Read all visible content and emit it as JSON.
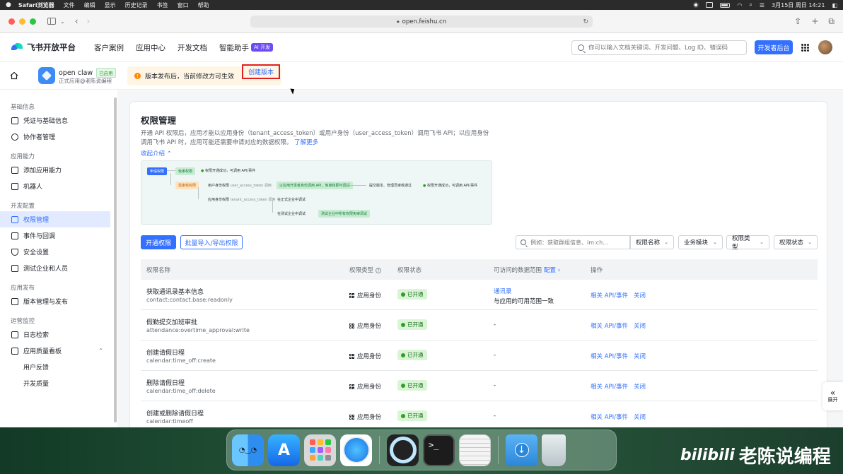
{
  "menubar": {
    "items": [
      "Safari浏览器",
      "文件",
      "编辑",
      "显示",
      "历史记录",
      "书签",
      "窗口",
      "帮助"
    ],
    "datetime": "3月15日 周日  14:21"
  },
  "browser": {
    "url": "open.feishu.cn"
  },
  "header": {
    "brand": "飞书开放平台",
    "nav": [
      "客户案例",
      "应用中心",
      "开发文档",
      "智能助手"
    ],
    "ai_badge": "AI 开发",
    "search_placeholder": "你可以输入文档关键词、开发问题、Log ID、错误码",
    "dev_console": "开发者后台"
  },
  "app": {
    "name": "open claw",
    "status": "已启用",
    "subtitle": "正式应用@老陈说编程",
    "notice": "版本发布后，当前修改方可生效",
    "create_version": "创建版本"
  },
  "sidebar": {
    "groups": [
      {
        "title": "基础信息",
        "items": [
          {
            "label": "凭证与基础信息"
          },
          {
            "label": "协作者管理"
          }
        ]
      },
      {
        "title": "应用能力",
        "items": [
          {
            "label": "添加应用能力"
          },
          {
            "label": "机器人"
          }
        ]
      },
      {
        "title": "开发配置",
        "items": [
          {
            "label": "权限管理"
          },
          {
            "label": "事件与回调"
          },
          {
            "label": "安全设置"
          },
          {
            "label": "测试企业和人员"
          }
        ]
      },
      {
        "title": "应用发布",
        "items": [
          {
            "label": "版本管理与发布"
          }
        ]
      },
      {
        "title": "运营监控",
        "items": [
          {
            "label": "日志检索"
          },
          {
            "label": "应用质量看板"
          },
          {
            "label": "用户反馈"
          },
          {
            "label": "开发质量"
          }
        ]
      }
    ]
  },
  "page": {
    "title": "权限管理",
    "desc": "开通 API 权限后，应用才能以应用身份（tenant_access_token）或用户身份（user_access_token）调用飞书 API；以应用身份调用飞书 API 时，应用可能还需要申请对应的数据权限。",
    "learn_more": "了解更多",
    "collapse": "收起介绍",
    "flow": {
      "start": "申请权限",
      "free": "免审权限",
      "free_result": "权限开通成功，可调用 API/事件",
      "review": "需审核权限",
      "user_perm": "用户身份权限",
      "user_token": "user_access_token 调用",
      "user_result": "以应用开发者身份调用 API，免审核即可调试",
      "submit": "提交版本、管理员审核通过",
      "final_result": "权限开通成功，可调用 API/事件",
      "app_perm": "应用身份权限",
      "app_token": "tenant_access_token 调用",
      "prod": "在正式企业中调试",
      "test": "在测试企业中调试",
      "test_result": "测试企业中所有权限免审调试"
    },
    "btn_open": "开通权限",
    "btn_import": "批量导入/导出权限",
    "search_placeholder": "例如：获取群组信息、im:ch...",
    "filters": [
      "权限名称",
      "业务模块",
      "权限类型",
      "权限状态"
    ]
  },
  "table": {
    "headers": {
      "name": "权限名称",
      "type": "权限类型",
      "status": "权限状态",
      "scope": "可访问的数据范围",
      "config": "配置",
      "ops": "操作"
    },
    "rows": [
      {
        "name": "获取通讯录基本信息",
        "code": "contact:contact.base:readonly",
        "type": "应用身份",
        "status": "已开通",
        "scope": "通讯录",
        "scope_sub": "与应用的可用范围一致",
        "op1": "相关 API/事件",
        "op2": "关闭"
      },
      {
        "name": "假勤提交加班审批",
        "code": "attendance:overtime_approval:write",
        "type": "应用身份",
        "status": "已开通",
        "scope": "-",
        "scope_sub": "",
        "op1": "相关 API/事件",
        "op2": "关闭"
      },
      {
        "name": "创建请假日程",
        "code": "calendar:time_off:create",
        "type": "应用身份",
        "status": "已开通",
        "scope": "-",
        "scope_sub": "",
        "op1": "相关 API/事件",
        "op2": "关闭"
      },
      {
        "name": "删除请假日程",
        "code": "calendar:time_off:delete",
        "type": "应用身份",
        "status": "已开通",
        "scope": "-",
        "scope_sub": "",
        "op1": "相关 API/事件",
        "op2": "关闭"
      },
      {
        "name": "创建或删除请假日程",
        "code": "calendar:timeoff",
        "type": "应用身份",
        "status": "已开通",
        "scope": "-",
        "scope_sub": "",
        "op1": "相关 API/事件",
        "op2": "关闭"
      }
    ]
  },
  "expand": "展开",
  "watermark": {
    "brand": "bilibili",
    "channel": "老陈说编程"
  },
  "colors": {
    "primary": "#3370ff",
    "success": "#2ea121",
    "warning": "#ff8800",
    "highlight_border": "#e02020"
  }
}
